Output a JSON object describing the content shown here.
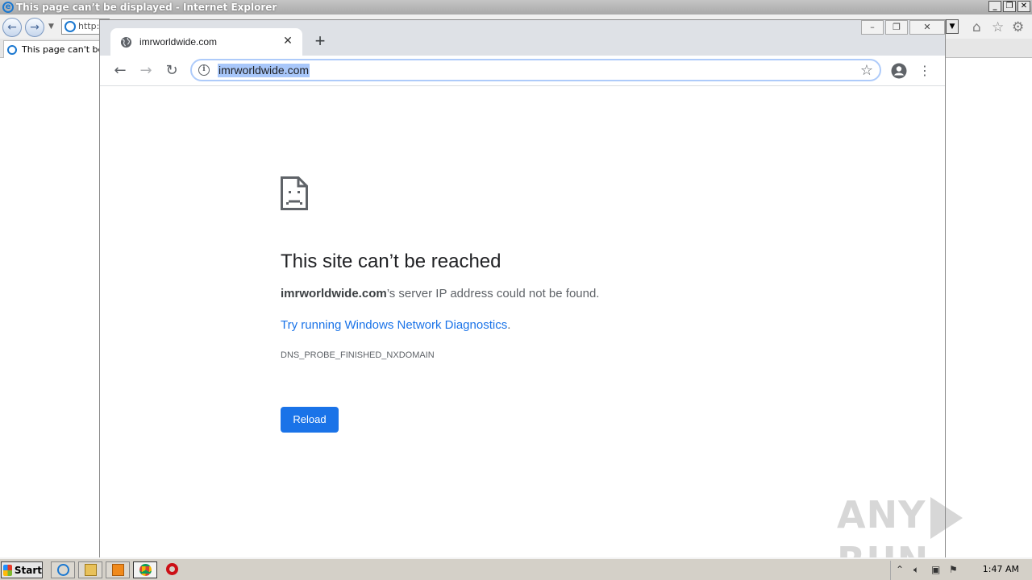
{
  "ie": {
    "title": "This page can’t be displayed - Internet Explorer",
    "address": "http://",
    "tab_title": "This page can't be displayed"
  },
  "chrome": {
    "tab_title": "imrworldwide.com",
    "url": "imrworldwide.com",
    "error": {
      "title": "This site can’t be reached",
      "host": "imrworldwide.com",
      "message_suffix": "’s server IP address could not be found.",
      "link_text": "Try running Windows Network Diagnostics",
      "link_suffix": ".",
      "code": "DNS_PROBE_FINISHED_NXDOMAIN",
      "reload_label": "Reload"
    }
  },
  "watermark": {
    "left": "ANY",
    "right": "RUN"
  },
  "taskbar": {
    "start_label": "Start",
    "clock": "1:47 AM"
  },
  "colors": {
    "chrome_accent": "#1a73e8",
    "tabstrip": "#dee1e6"
  }
}
